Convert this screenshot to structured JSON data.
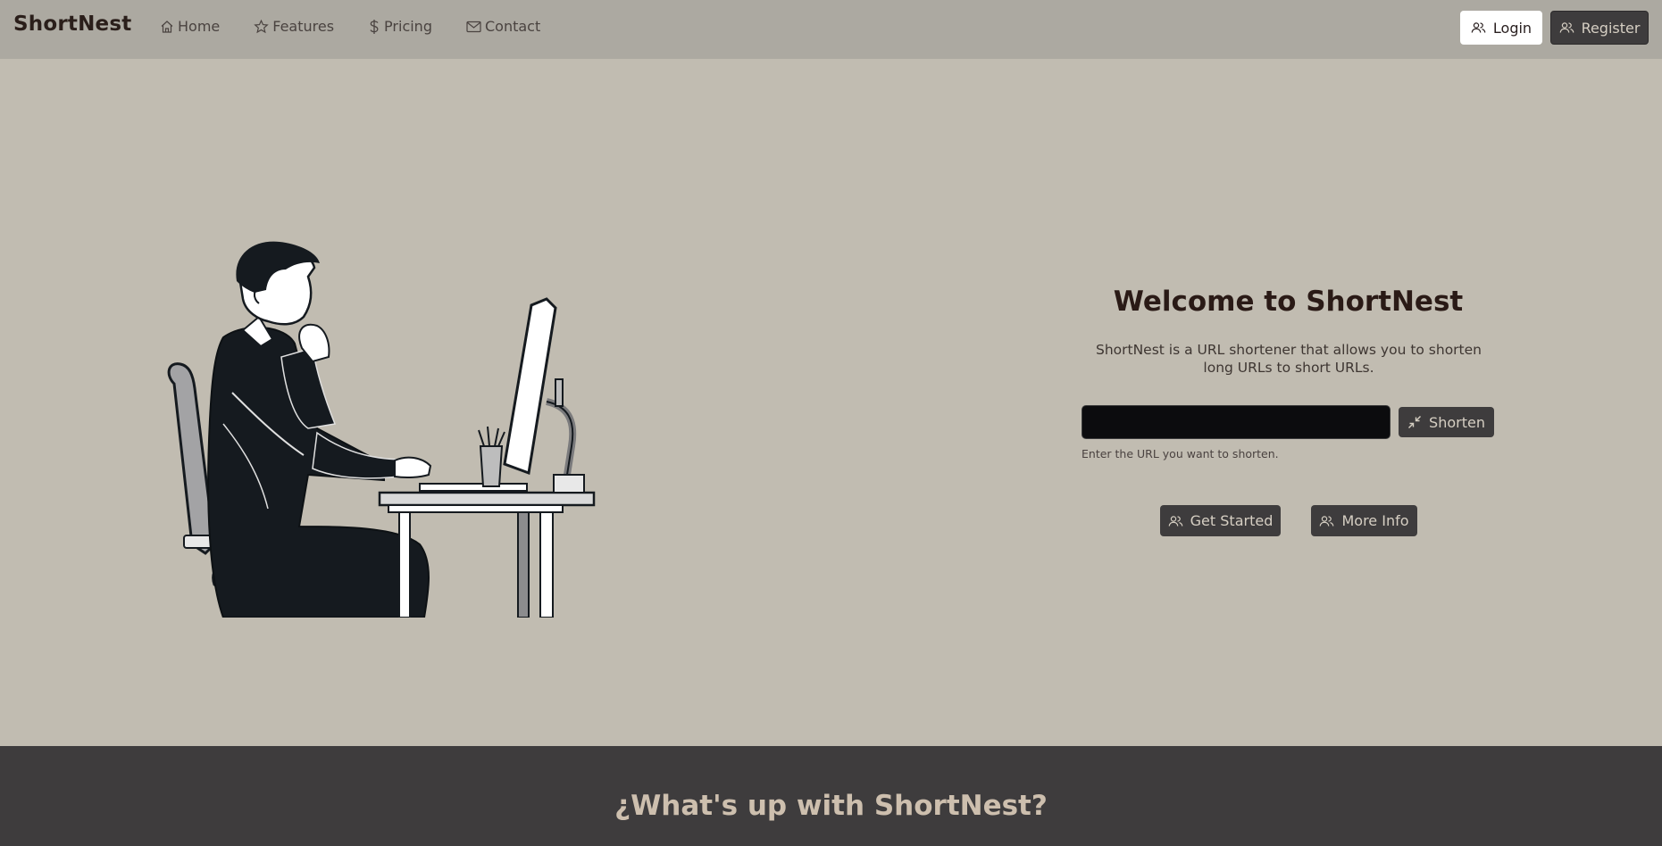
{
  "navbar": {
    "brand": "ShortNest",
    "links": [
      {
        "label": "Home",
        "icon": "home-icon"
      },
      {
        "label": "Features",
        "icon": "star-icon"
      },
      {
        "label": "Pricing",
        "icon": "dollar-icon"
      },
      {
        "label": "Contact",
        "icon": "envelope-icon"
      }
    ],
    "login_label": "Login",
    "register_label": "Register"
  },
  "hero": {
    "title": "Welcome to ShortNest",
    "description": "ShortNest is a URL shortener that allows you to shorten long URLs to short URLs.",
    "url_input_value": "",
    "url_input_placeholder": "",
    "shorten_label": "Shorten",
    "help_text": "Enter the URL you want to shorten.",
    "get_started_label": "Get Started",
    "more_info_label": "More Info"
  },
  "section": {
    "title": "¿What's up with ShortNest?"
  },
  "colors": {
    "navbar_bg": "#aca9a1",
    "hero_bg": "#c1bcb1",
    "dark_button": "#3e3c3d",
    "section_bg": "#3e3c3d",
    "section_title": "#cdbfae"
  }
}
